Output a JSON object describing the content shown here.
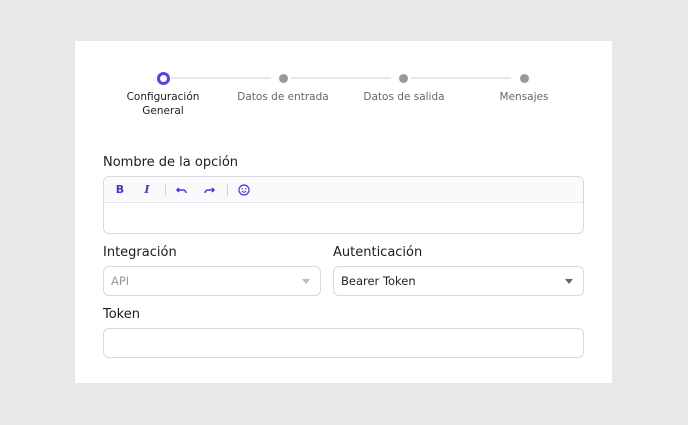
{
  "stepper": {
    "steps": [
      {
        "label": "Configuración General",
        "active": true
      },
      {
        "label": "Datos de entrada",
        "active": false
      },
      {
        "label": "Datos de salida",
        "active": false
      },
      {
        "label": "Mensajes",
        "active": false
      }
    ],
    "accent_color": "#5b3ee8"
  },
  "option_name": {
    "label": "Nombre de la opción",
    "value": "",
    "toolbar": {
      "bold": "B",
      "italic": "I",
      "undo_icon": "undo-icon",
      "redo_icon": "redo-icon",
      "emoji_icon": "emoji-icon"
    }
  },
  "integration": {
    "label": "Integración",
    "value": "API"
  },
  "authentication": {
    "label": "Autenticación",
    "value": "Bearer Token"
  },
  "token": {
    "label": "Token",
    "value": ""
  }
}
